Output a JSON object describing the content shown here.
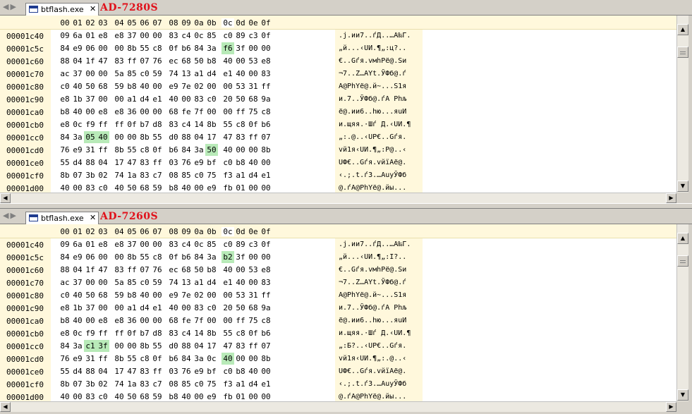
{
  "columns": [
    "00",
    "01",
    "02",
    "03",
    "04",
    "05",
    "06",
    "07",
    "08",
    "09",
    "0a",
    "0b",
    "0c",
    "0d",
    "0e",
    "0f"
  ],
  "active_column": 12,
  "nav_arrows": "◀▶",
  "icons": {
    "tab": "window-icon",
    "close": "close-icon",
    "scroll_up": "arrow-up-icon",
    "scroll_down": "arrow-down-icon",
    "scroll_left": "arrow-left-icon",
    "scroll_right": "arrow-right-icon"
  },
  "colors": {
    "annotation": "#e0101a",
    "highlight": "#b8eab8",
    "header_bg": "#fff8dc"
  },
  "panes": [
    {
      "tab_label": "btflash.exe",
      "close_label": "✕",
      "annotation": "AD-7280S",
      "rows": [
        {
          "offset": "00001c40",
          "bytes": [
            "09",
            "6a",
            "01",
            "e8",
            "e8",
            "37",
            "00",
            "00",
            "83",
            "c4",
            "0c",
            "85",
            "c0",
            "89",
            "c3",
            "0f"
          ],
          "ascii": ".j.ии7..ѓД..…А‰Г.",
          "hl": []
        },
        {
          "offset": "00001c5c",
          "bytes": [
            "84",
            "e9",
            "06",
            "00",
            "00",
            "8b",
            "55",
            "c8",
            "0f",
            "b6",
            "84",
            "3a",
            "f6",
            "3f",
            "00",
            "00"
          ],
          "ascii": "„й...‹UИ.¶„:ц?..",
          "hl": [
            12
          ]
        },
        {
          "offset": "00001c60",
          "bytes": [
            "88",
            "04",
            "1f",
            "47",
            "83",
            "ff",
            "07",
            "76",
            "ec",
            "68",
            "50",
            "b8",
            "40",
            "00",
            "53",
            "e8"
          ],
          "ascii": "€..Gѓя.vмhPё@.Sи",
          "hl": []
        },
        {
          "offset": "00001c70",
          "bytes": [
            "ac",
            "37",
            "00",
            "00",
            "5a",
            "85",
            "c0",
            "59",
            "74",
            "13",
            "a1",
            "d4",
            "e1",
            "40",
            "00",
            "83"
          ],
          "ascii": "¬7..Z…АYt.ЎФб@.ѓ",
          "hl": []
        },
        {
          "offset": "00001c80",
          "bytes": [
            "c0",
            "40",
            "50",
            "68",
            "59",
            "b8",
            "40",
            "00",
            "e9",
            "7e",
            "02",
            "00",
            "00",
            "53",
            "31",
            "ff"
          ],
          "ascii": "А@PhYё@.й~...S1я",
          "hl": []
        },
        {
          "offset": "00001c90",
          "bytes": [
            "e8",
            "1b",
            "37",
            "00",
            "00",
            "a1",
            "d4",
            "e1",
            "40",
            "00",
            "83",
            "c0",
            "20",
            "50",
            "68",
            "9a"
          ],
          "ascii": "и.7..ЎФб@.ѓА Phљ",
          "hl": []
        },
        {
          "offset": "00001ca0",
          "bytes": [
            "b8",
            "40",
            "00",
            "e8",
            "e8",
            "36",
            "00",
            "00",
            "68",
            "fe",
            "7f",
            "00",
            "00",
            "ff",
            "75",
            "c8"
          ],
          "ascii": "ё@.ии6..hю...яuИ",
          "hl": []
        },
        {
          "offset": "00001cb0",
          "bytes": [
            "e8",
            "0c",
            "f9",
            "ff",
            "ff",
            "0f",
            "b7",
            "d8",
            "83",
            "c4",
            "14",
            "8b",
            "55",
            "c8",
            "0f",
            "b6"
          ],
          "ascii": "и.щяя.·Шѓ Д.‹UИ.¶",
          "hl": []
        },
        {
          "offset": "00001cc0",
          "bytes": [
            "84",
            "3a",
            "05",
            "40",
            "00",
            "00",
            "8b",
            "55",
            "d0",
            "88",
            "04",
            "17",
            "47",
            "83",
            "ff",
            "07"
          ],
          "ascii": "„:.@..‹UР€..Gѓя.",
          "hl": [
            2,
            3
          ]
        },
        {
          "offset": "00001cd0",
          "bytes": [
            "76",
            "e9",
            "31",
            "ff",
            "8b",
            "55",
            "c8",
            "0f",
            "b6",
            "84",
            "3a",
            "50",
            "40",
            "00",
            "00",
            "8b"
          ],
          "ascii": "vй1я‹UИ.¶„:P@..‹",
          "hl": [
            11
          ]
        },
        {
          "offset": "00001ce0",
          "bytes": [
            "55",
            "d4",
            "88",
            "04",
            "17",
            "47",
            "83",
            "ff",
            "03",
            "76",
            "e9",
            "bf",
            "c0",
            "b8",
            "40",
            "00"
          ],
          "ascii": "UФ€..Gѓя.vйїАё@.",
          "hl": []
        },
        {
          "offset": "00001cf0",
          "bytes": [
            "8b",
            "07",
            "3b",
            "02",
            "74",
            "1a",
            "83",
            "c7",
            "08",
            "85",
            "c0",
            "75",
            "f3",
            "a1",
            "d4",
            "e1"
          ],
          "ascii": "‹.;.t.ѓЗ.…АuуЎФб",
          "hl": []
        },
        {
          "offset": "00001d00",
          "bytes": [
            "40",
            "00",
            "83",
            "c0",
            "40",
            "50",
            "68",
            "59",
            "b8",
            "40",
            "00",
            "e9",
            "fb",
            "01",
            "00",
            "00"
          ],
          "ascii": "@.ѓА@PhYё@.йы...",
          "hl": []
        }
      ]
    },
    {
      "tab_label": "btflash.exe",
      "close_label": "✕",
      "annotation": "AD-7260S",
      "rows": [
        {
          "offset": "00001c40",
          "bytes": [
            "09",
            "6a",
            "01",
            "e8",
            "e8",
            "37",
            "00",
            "00",
            "83",
            "c4",
            "0c",
            "85",
            "c0",
            "89",
            "c3",
            "0f"
          ],
          "ascii": ".j.ии7..ѓД..…А‰Г.",
          "hl": []
        },
        {
          "offset": "00001c5c",
          "bytes": [
            "84",
            "e9",
            "06",
            "00",
            "00",
            "8b",
            "55",
            "c8",
            "0f",
            "b6",
            "84",
            "3a",
            "b2",
            "3f",
            "00",
            "00"
          ],
          "ascii": "„й...‹UИ.¶„:І?..",
          "hl": [
            12
          ]
        },
        {
          "offset": "00001c60",
          "bytes": [
            "88",
            "04",
            "1f",
            "47",
            "83",
            "ff",
            "07",
            "76",
            "ec",
            "68",
            "50",
            "b8",
            "40",
            "00",
            "53",
            "e8"
          ],
          "ascii": "€..Gѓя.vмhPё@.Sи",
          "hl": []
        },
        {
          "offset": "00001c70",
          "bytes": [
            "ac",
            "37",
            "00",
            "00",
            "5a",
            "85",
            "c0",
            "59",
            "74",
            "13",
            "a1",
            "d4",
            "e1",
            "40",
            "00",
            "83"
          ],
          "ascii": "¬7..Z…АYt.ЎФб@.ѓ",
          "hl": []
        },
        {
          "offset": "00001c80",
          "bytes": [
            "c0",
            "40",
            "50",
            "68",
            "59",
            "b8",
            "40",
            "00",
            "e9",
            "7e",
            "02",
            "00",
            "00",
            "53",
            "31",
            "ff"
          ],
          "ascii": "А@PhYё@.й~...S1я",
          "hl": []
        },
        {
          "offset": "00001c90",
          "bytes": [
            "e8",
            "1b",
            "37",
            "00",
            "00",
            "a1",
            "d4",
            "e1",
            "40",
            "00",
            "83",
            "c0",
            "20",
            "50",
            "68",
            "9a"
          ],
          "ascii": "и.7..ЎФб@.ѓА Phљ",
          "hl": []
        },
        {
          "offset": "00001ca0",
          "bytes": [
            "b8",
            "40",
            "00",
            "e8",
            "e8",
            "36",
            "00",
            "00",
            "68",
            "fe",
            "7f",
            "00",
            "00",
            "ff",
            "75",
            "c8"
          ],
          "ascii": "ё@.ии6..hю...яuИ",
          "hl": []
        },
        {
          "offset": "00001cb0",
          "bytes": [
            "e8",
            "0c",
            "f9",
            "ff",
            "ff",
            "0f",
            "b7",
            "d8",
            "83",
            "c4",
            "14",
            "8b",
            "55",
            "c8",
            "0f",
            "b6"
          ],
          "ascii": "и.щяя.·Шѓ Д.‹UИ.¶",
          "hl": []
        },
        {
          "offset": "00001cc0",
          "bytes": [
            "84",
            "3a",
            "c1",
            "3f",
            "00",
            "00",
            "8b",
            "55",
            "d0",
            "88",
            "04",
            "17",
            "47",
            "83",
            "ff",
            "07"
          ],
          "ascii": "„:Б?..‹UР€..Gѓя.",
          "hl": [
            2,
            3
          ]
        },
        {
          "offset": "00001cd0",
          "bytes": [
            "76",
            "e9",
            "31",
            "ff",
            "8b",
            "55",
            "c8",
            "0f",
            "b6",
            "84",
            "3a",
            "0c",
            "40",
            "00",
            "00",
            "8b"
          ],
          "ascii": "vй1я‹UИ.¶„:.@..‹",
          "hl": [
            12
          ]
        },
        {
          "offset": "00001ce0",
          "bytes": [
            "55",
            "d4",
            "88",
            "04",
            "17",
            "47",
            "83",
            "ff",
            "03",
            "76",
            "e9",
            "bf",
            "c0",
            "b8",
            "40",
            "00"
          ],
          "ascii": "UФ€..Gѓя.vйїАё@.",
          "hl": []
        },
        {
          "offset": "00001cf0",
          "bytes": [
            "8b",
            "07",
            "3b",
            "02",
            "74",
            "1a",
            "83",
            "c7",
            "08",
            "85",
            "c0",
            "75",
            "f3",
            "a1",
            "d4",
            "e1"
          ],
          "ascii": "‹.;.t.ѓЗ.…АuуЎФб",
          "hl": []
        },
        {
          "offset": "00001d00",
          "bytes": [
            "40",
            "00",
            "83",
            "c0",
            "40",
            "50",
            "68",
            "59",
            "b8",
            "40",
            "00",
            "e9",
            "fb",
            "01",
            "00",
            "00"
          ],
          "ascii": "@.ѓА@PhYё@.йы...",
          "hl": []
        }
      ]
    }
  ]
}
